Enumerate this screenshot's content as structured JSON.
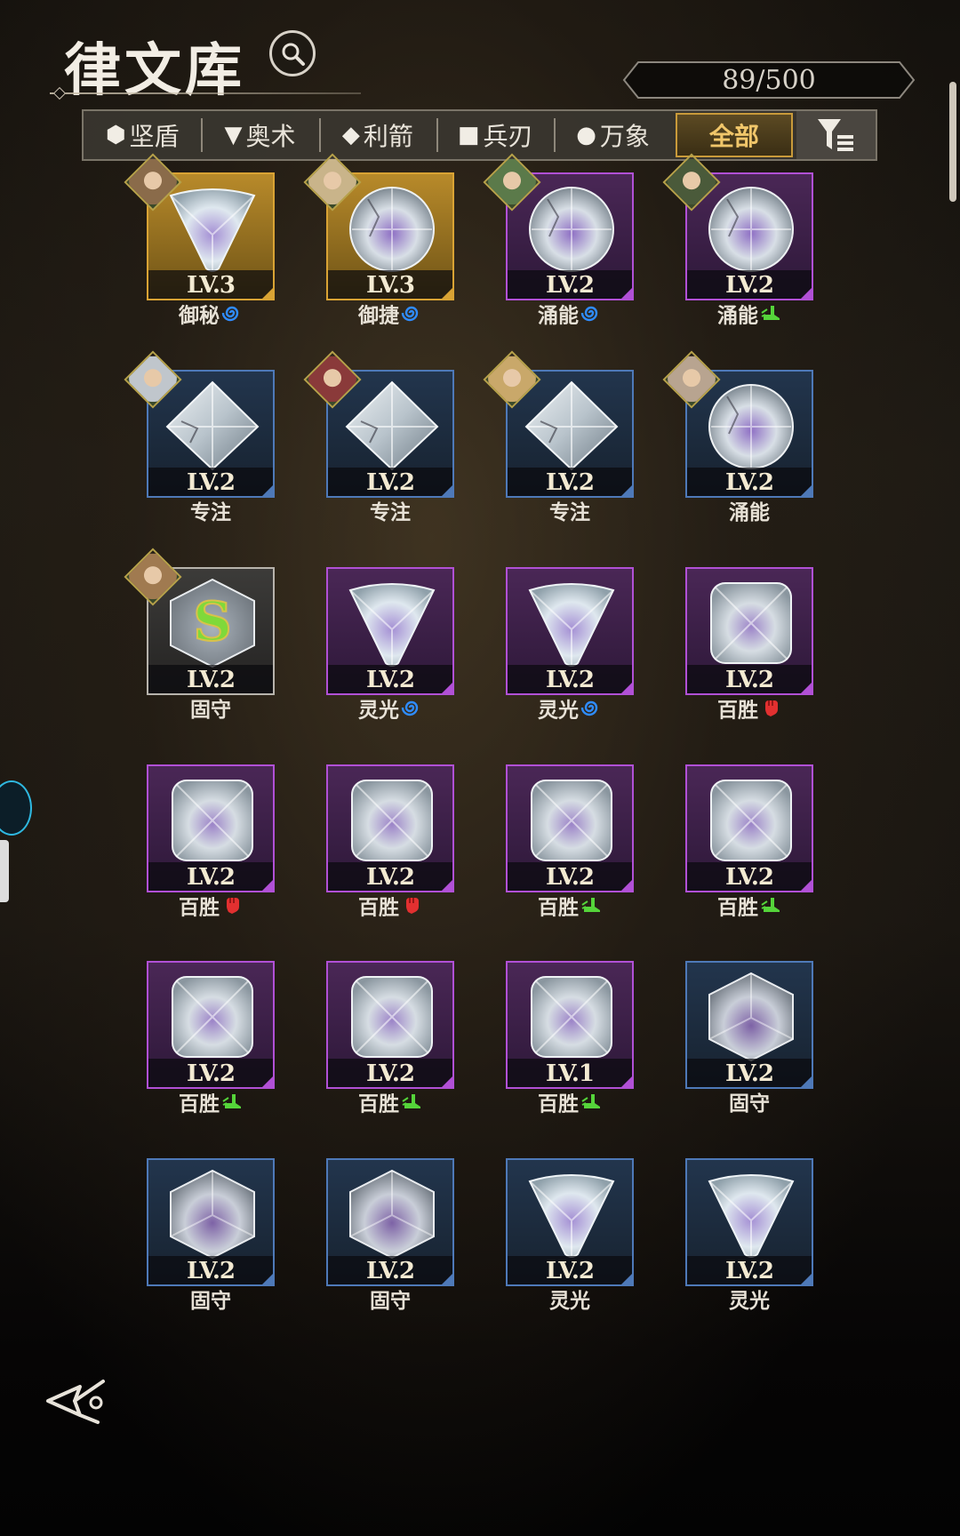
{
  "header": {
    "title": "律文库",
    "counter": "89/500"
  },
  "tabs": [
    {
      "glyph": "⬢",
      "label": "坚盾",
      "active": false
    },
    {
      "glyph": "▼",
      "label": "奥术",
      "active": false
    },
    {
      "glyph": "◆",
      "label": "利箭",
      "active": false
    },
    {
      "glyph": "■",
      "label": "兵刃",
      "active": false
    },
    {
      "glyph": "●",
      "label": "万象",
      "active": false
    },
    {
      "glyph": "",
      "label": "全部",
      "active": true
    }
  ],
  "colors": {
    "gold": "#d9a334",
    "purple": "#b150d6",
    "blue": "#4e79b8",
    "grey": "#b7b3ac",
    "active_tab_text": "#f0c66a"
  },
  "items": [
    {
      "level": "LV.3",
      "name": "御秘",
      "rarity": "gold",
      "shape": "triangle",
      "suffix": "swirl-icon",
      "avatar": true
    },
    {
      "level": "LV.3",
      "name": "御捷",
      "rarity": "gold",
      "shape": "round",
      "suffix": "swirl-icon",
      "avatar": true
    },
    {
      "level": "LV.2",
      "name": "涌能",
      "rarity": "purple",
      "shape": "round",
      "suffix": "swirl-icon",
      "avatar": true
    },
    {
      "level": "LV.2",
      "name": "涌能",
      "rarity": "purple",
      "shape": "round",
      "suffix": "boot-icon",
      "avatar": true
    },
    {
      "level": "LV.2",
      "name": "专注",
      "rarity": "blue",
      "shape": "diamond",
      "suffix": "",
      "avatar": true
    },
    {
      "level": "LV.2",
      "name": "专注",
      "rarity": "blue",
      "shape": "diamond",
      "suffix": "",
      "avatar": true
    },
    {
      "level": "LV.2",
      "name": "专注",
      "rarity": "blue",
      "shape": "diamond",
      "suffix": "",
      "avatar": true
    },
    {
      "level": "LV.2",
      "name": "涌能",
      "rarity": "blue",
      "shape": "round",
      "suffix": "",
      "avatar": true
    },
    {
      "level": "LV.2",
      "name": "固守",
      "rarity": "grey",
      "shape": "hexagon-s",
      "suffix": "",
      "avatar": true
    },
    {
      "level": "LV.2",
      "name": "灵光",
      "rarity": "purple",
      "shape": "triangle",
      "suffix": "swirl-icon",
      "avatar": false
    },
    {
      "level": "LV.2",
      "name": "灵光",
      "rarity": "purple",
      "shape": "triangle",
      "suffix": "swirl-icon",
      "avatar": false
    },
    {
      "level": "LV.2",
      "name": "百胜",
      "rarity": "purple",
      "shape": "square",
      "suffix": "fist-icon",
      "avatar": false
    },
    {
      "level": "LV.2",
      "name": "百胜",
      "rarity": "purple",
      "shape": "square",
      "suffix": "fist-icon",
      "avatar": false
    },
    {
      "level": "LV.2",
      "name": "百胜",
      "rarity": "purple",
      "shape": "square",
      "suffix": "fist-icon",
      "avatar": false
    },
    {
      "level": "LV.2",
      "name": "百胜",
      "rarity": "purple",
      "shape": "square",
      "suffix": "boot-icon",
      "avatar": false
    },
    {
      "level": "LV.2",
      "name": "百胜",
      "rarity": "purple",
      "shape": "square",
      "suffix": "boot-icon",
      "avatar": false
    },
    {
      "level": "LV.2",
      "name": "百胜",
      "rarity": "purple",
      "shape": "square",
      "suffix": "boot-icon",
      "avatar": false
    },
    {
      "level": "LV.2",
      "name": "百胜",
      "rarity": "purple",
      "shape": "square",
      "suffix": "boot-icon",
      "avatar": false
    },
    {
      "level": "LV.1",
      "name": "百胜",
      "rarity": "purple",
      "shape": "square",
      "suffix": "boot-icon",
      "avatar": false
    },
    {
      "level": "LV.2",
      "name": "固守",
      "rarity": "blue",
      "shape": "hexagon",
      "suffix": "",
      "avatar": false
    },
    {
      "level": "LV.2",
      "name": "固守",
      "rarity": "blue",
      "shape": "hexagon",
      "suffix": "",
      "avatar": false
    },
    {
      "level": "LV.2",
      "name": "固守",
      "rarity": "blue",
      "shape": "hexagon",
      "suffix": "",
      "avatar": false
    },
    {
      "level": "LV.2",
      "name": "灵光",
      "rarity": "blue",
      "shape": "triangle",
      "suffix": "",
      "avatar": false
    },
    {
      "level": "LV.2",
      "name": "灵光",
      "rarity": "blue",
      "shape": "triangle",
      "suffix": "",
      "avatar": false
    }
  ]
}
